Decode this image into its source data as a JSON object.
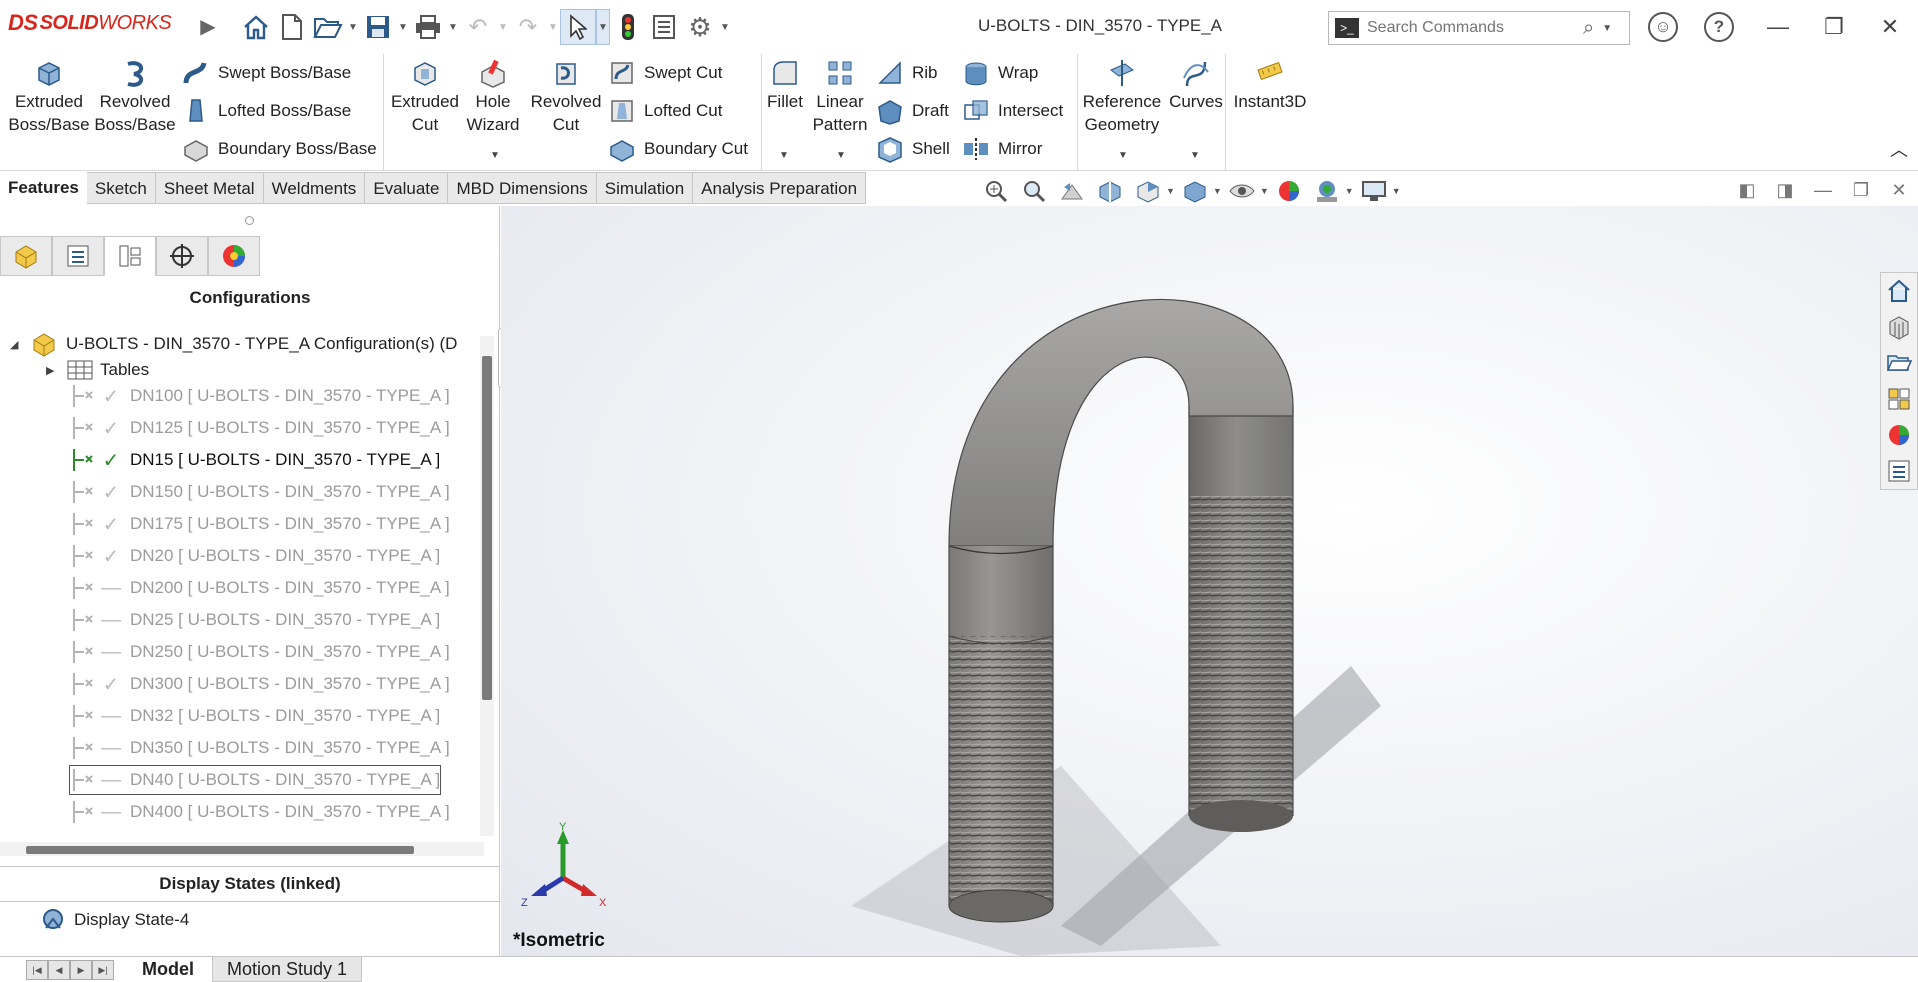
{
  "app": {
    "brand_prefix": "DS",
    "brand_bold": "SOLID",
    "brand_rest": "WORKS",
    "document_title": "U-BOLTS - DIN_3570 - TYPE_A"
  },
  "search": {
    "placeholder": "Search Commands"
  },
  "ribbon": {
    "extruded_boss": "Extruded Boss/Base",
    "revolved_boss": "Revolved Boss/Base",
    "swept_boss": "Swept Boss/Base",
    "lofted_boss": "Lofted Boss/Base",
    "boundary_boss": "Boundary Boss/Base",
    "extruded_cut": "Extruded Cut",
    "hole_wizard": "Hole Wizard",
    "revolved_cut": "Revolved Cut",
    "swept_cut": "Swept Cut",
    "lofted_cut": "Lofted Cut",
    "boundary_cut": "Boundary Cut",
    "fillet": "Fillet",
    "linear_pattern": "Linear Pattern",
    "rib": "Rib",
    "draft": "Draft",
    "shell": "Shell",
    "wrap": "Wrap",
    "intersect": "Intersect",
    "mirror": "Mirror",
    "reference_geometry": "Reference Geometry",
    "curves": "Curves",
    "instant3d": "Instant3D"
  },
  "tabs": [
    "Features",
    "Sketch",
    "Sheet Metal",
    "Weldments",
    "Evaluate",
    "MBD Dimensions",
    "Simulation",
    "Analysis Preparation"
  ],
  "panel": {
    "header": "Configurations",
    "root_label": "U-BOLTS - DIN_3570 - TYPE_A Configuration(s)  (D",
    "tables_label": "Tables",
    "configs": [
      {
        "label": "DN100 [ U-BOLTS - DIN_3570 - TYPE_A ]",
        "mark": "✓",
        "state": "check"
      },
      {
        "label": "DN125 [ U-BOLTS - DIN_3570 - TYPE_A ]",
        "mark": "✓",
        "state": "check"
      },
      {
        "label": "DN15 [ U-BOLTS - DIN_3570 - TYPE_A ]",
        "mark": "✓",
        "state": "active"
      },
      {
        "label": "DN150 [ U-BOLTS - DIN_3570 - TYPE_A ]",
        "mark": "✓",
        "state": "check"
      },
      {
        "label": "DN175 [ U-BOLTS - DIN_3570 - TYPE_A ]",
        "mark": "✓",
        "state": "check"
      },
      {
        "label": "DN20 [ U-BOLTS - DIN_3570 - TYPE_A ]",
        "mark": "✓",
        "state": "check"
      },
      {
        "label": "DN200 [ U-BOLTS - DIN_3570 - TYPE_A ]",
        "mark": "—",
        "state": "dash"
      },
      {
        "label": "DN25 [ U-BOLTS - DIN_3570 - TYPE_A ]",
        "mark": "—",
        "state": "dash"
      },
      {
        "label": "DN250 [ U-BOLTS - DIN_3570 - TYPE_A ]",
        "mark": "—",
        "state": "dash"
      },
      {
        "label": "DN300 [ U-BOLTS - DIN_3570 - TYPE_A ]",
        "mark": "✓",
        "state": "check"
      },
      {
        "label": "DN32 [ U-BOLTS - DIN_3570 - TYPE_A ]",
        "mark": "—",
        "state": "dash"
      },
      {
        "label": "DN350 [ U-BOLTS - DIN_3570 - TYPE_A ]",
        "mark": "—",
        "state": "dash"
      },
      {
        "label": "DN40 [ U-BOLTS - DIN_3570 - TYPE_A ]",
        "mark": "—",
        "state": "selected"
      },
      {
        "label": "DN400 [ U-BOLTS - DIN_3570 - TYPE_A ]",
        "mark": "—",
        "state": "dash"
      }
    ],
    "display_states_header": "Display States (linked)",
    "display_state_item": "Display State-4"
  },
  "viewport": {
    "view_label": "*Isometric",
    "axis_x": "X",
    "axis_y": "Y",
    "axis_z": "Z"
  },
  "bottom_tabs": {
    "model": "Model",
    "motion_study": "Motion Study 1"
  },
  "colors": {
    "brand_red": "#d9261c",
    "active_check": "#2b8a2b",
    "model_gray": "#8a8987"
  }
}
